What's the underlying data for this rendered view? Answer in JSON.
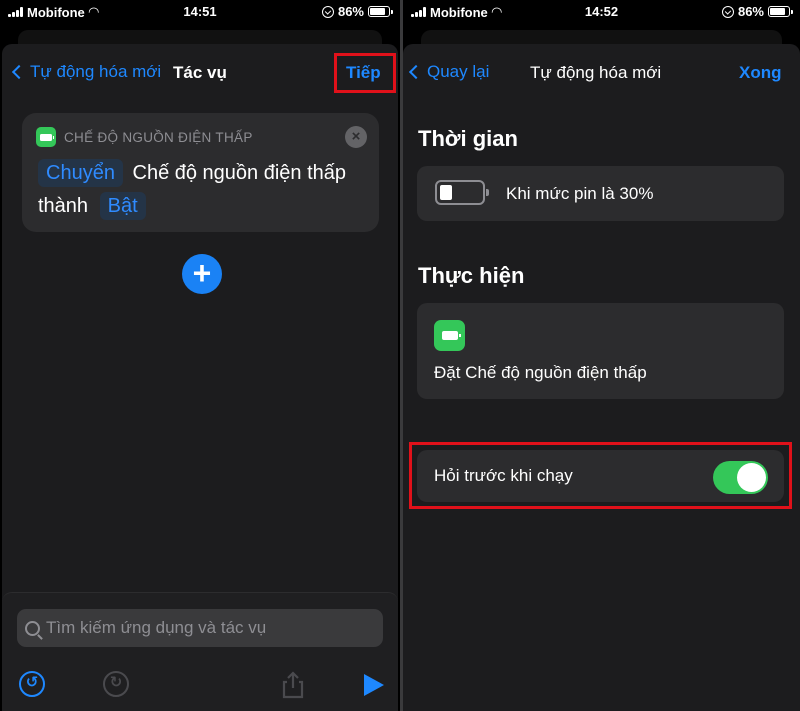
{
  "left": {
    "status": {
      "carrier": "Mobifone",
      "time": "14:51",
      "battery": "86%"
    },
    "nav": {
      "back_label": "Tự động hóa mới",
      "title": "Tác vụ",
      "action_label": "Tiếp"
    },
    "action_card": {
      "header": "CHẾ ĐỘ NGUỒN ĐIỆN THẤP",
      "token_action": "Chuyển",
      "text_middle": "Chế độ nguồn điện thấp thành",
      "token_value": "Bật"
    },
    "search": {
      "placeholder": "Tìm kiếm ứng dụng và tác vụ"
    }
  },
  "right": {
    "status": {
      "carrier": "Mobifone",
      "time": "14:52",
      "battery": "86%"
    },
    "nav": {
      "back_label": "Quay lại",
      "title": "Tự động hóa mới",
      "action_label": "Xong"
    },
    "time_section": {
      "title": "Thời gian",
      "trigger_text": "Khi mức pin là 30%",
      "battery_level": 0.3
    },
    "do_section": {
      "title": "Thực hiện",
      "action_text": "Đặt Chế độ nguồn điện thấp"
    },
    "ask_toggle": {
      "label": "Hỏi trước khi chạy",
      "on": true
    }
  },
  "colors": {
    "accent": "#1e88ff",
    "green": "#34c759",
    "highlight": "#e0111a"
  }
}
